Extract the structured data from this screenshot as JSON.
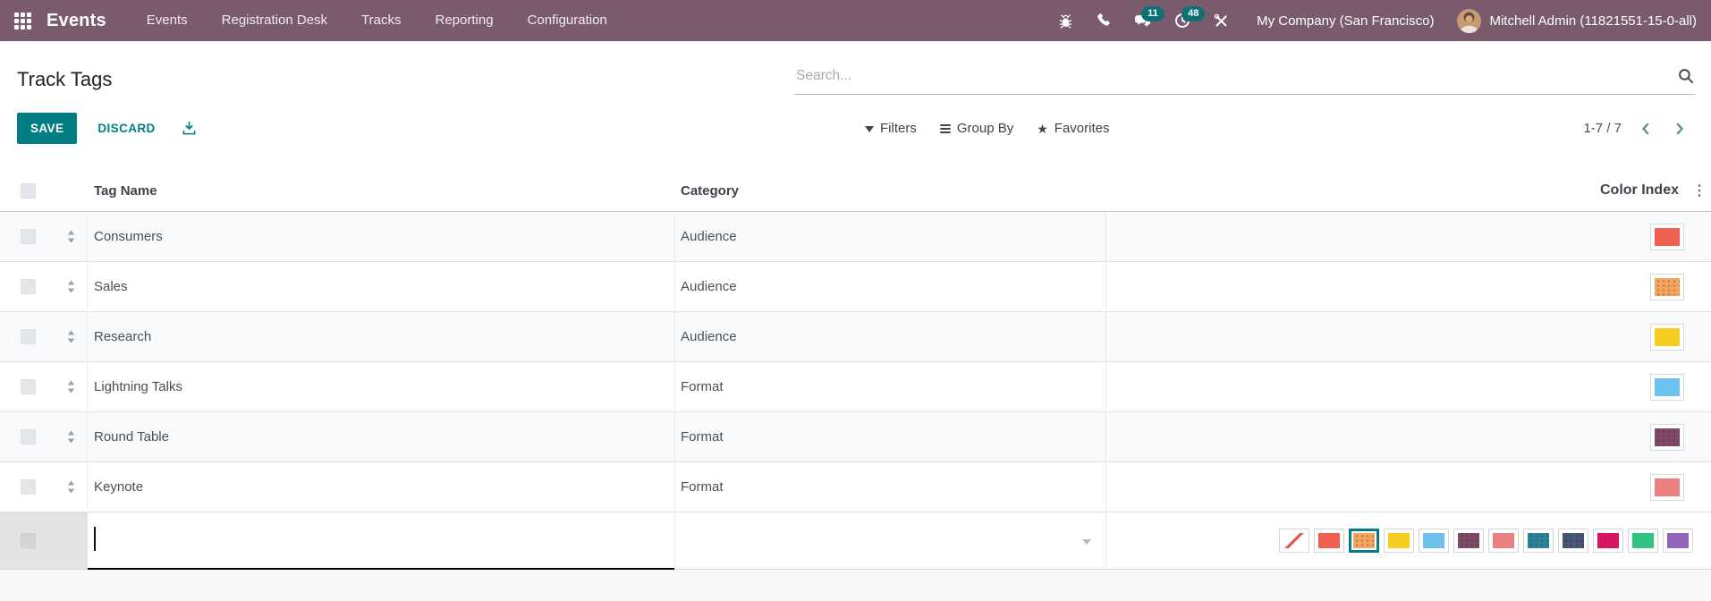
{
  "navbar": {
    "app_name": "Events",
    "menu_items": [
      "Events",
      "Registration Desk",
      "Tracks",
      "Reporting",
      "Configuration"
    ],
    "messages_badge": "11",
    "activities_badge": "48",
    "company_name": "My Company (San Francisco)",
    "user_name": "Mitchell Admin (11821551-15-0-all)"
  },
  "page": {
    "title": "Track Tags",
    "search_placeholder": "Search..."
  },
  "toolbar": {
    "save_label": "SAVE",
    "discard_label": "DISCARD"
  },
  "search_panel": {
    "filters_label": "Filters",
    "group_by_label": "Group By",
    "favorites_label": "Favorites"
  },
  "pager": {
    "text": "1-7 / 7"
  },
  "icons": {
    "star": "★",
    "more_columns": "⋮"
  },
  "table": {
    "columns": [
      "Tag Name",
      "Category",
      "Color Index"
    ],
    "rows": [
      {
        "tag_name": "Consumers",
        "category": "Audience",
        "color": "#F06050"
      },
      {
        "tag_name": "Sales",
        "category": "Audience",
        "color": "#F4A460"
      },
      {
        "tag_name": "Research",
        "category": "Audience",
        "color": "#F7CD1F"
      },
      {
        "tag_name": "Lightning Talks",
        "category": "Format",
        "color": "#6CC1ED"
      },
      {
        "tag_name": "Round Table",
        "category": "Format",
        "color": "#814968"
      },
      {
        "tag_name": "Keynote",
        "category": "Format",
        "color": "#EB7E7F"
      }
    ],
    "new_row": {
      "tag_name_value": "",
      "category_value": "",
      "selected_color_index": 2,
      "color_options": [
        "none",
        "#F06050",
        "#F4A460",
        "#F7CD1F",
        "#6CC1ED",
        "#814968",
        "#EB7E7F",
        "#2C8397",
        "#475577",
        "#D6145F",
        "#30C381",
        "#9365B8"
      ]
    }
  },
  "colors": {
    "navbar_bg": "#7A5B6E",
    "accent_teal": "#017E84",
    "badge_bg": "#0E7175",
    "pager_chevron": "#578E98"
  }
}
